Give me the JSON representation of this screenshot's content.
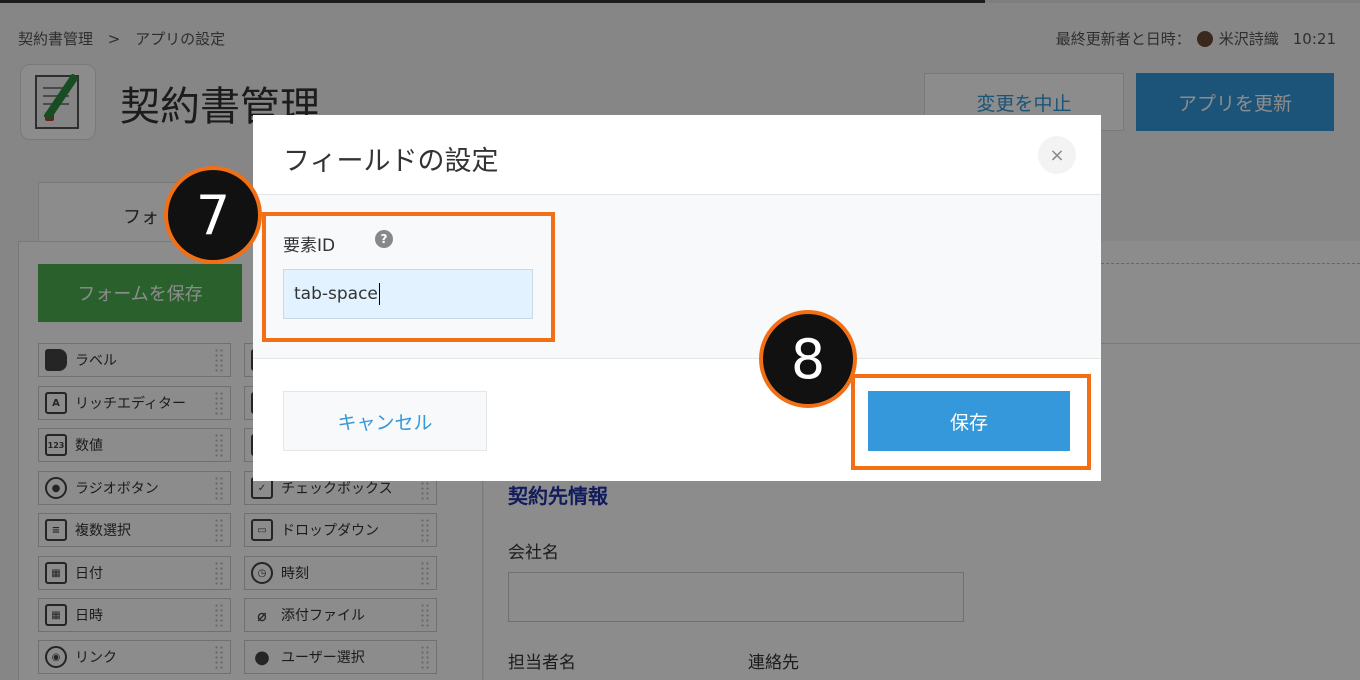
{
  "breadcrumb": {
    "app": "契約書管理",
    "sep": ">",
    "page": "アプリの設定"
  },
  "meta": {
    "prefix": "最終更新者と日時：",
    "user": "米沢詩織",
    "time": "10:21"
  },
  "app": {
    "title": "契約書管理"
  },
  "header": {
    "cancel_label": "変更を中止",
    "update_label": "アプリを更新"
  },
  "tabs": {
    "form": "フォ"
  },
  "palette": {
    "save_label": "フォームを保存",
    "items": [
      {
        "label": "ラベル",
        "icon": "tag-icon"
      },
      {
        "label": "リッチエディター",
        "icon": "rich-editor-icon"
      },
      {
        "label": "数値",
        "icon": "number-icon"
      },
      {
        "label": "ラジオボタン",
        "icon": "radio-icon"
      },
      {
        "label": "チェックボックス",
        "icon": "checkbox-icon"
      },
      {
        "label": "複数選択",
        "icon": "multi-select-icon"
      },
      {
        "label": "ドロップダウン",
        "icon": "dropdown-icon"
      },
      {
        "label": "日付",
        "icon": "calendar-icon"
      },
      {
        "label": "時刻",
        "icon": "clock-icon"
      },
      {
        "label": "日時",
        "icon": "datetime-icon"
      },
      {
        "label": "添付ファイル",
        "icon": "paperclip-icon"
      },
      {
        "label": "リンク",
        "icon": "link-icon"
      },
      {
        "label": "ユーザー選択",
        "icon": "user-icon"
      }
    ]
  },
  "preview": {
    "section": "契約先情報",
    "company_label": "会社名",
    "person_label": "担当者名",
    "contact_label": "連絡先"
  },
  "modal": {
    "title": "フィールドの設定",
    "close": "×",
    "field_label": "要素ID",
    "help": "?",
    "input_value": "tab-space",
    "cancel_label": "キャンセル",
    "save_label": "保存"
  },
  "annotations": {
    "step7": "7",
    "step8": "8",
    "highlight_color": "#f36f15"
  },
  "colors": {
    "primary": "#3498db",
    "green": "#4caf50",
    "section": "#2233aa"
  }
}
